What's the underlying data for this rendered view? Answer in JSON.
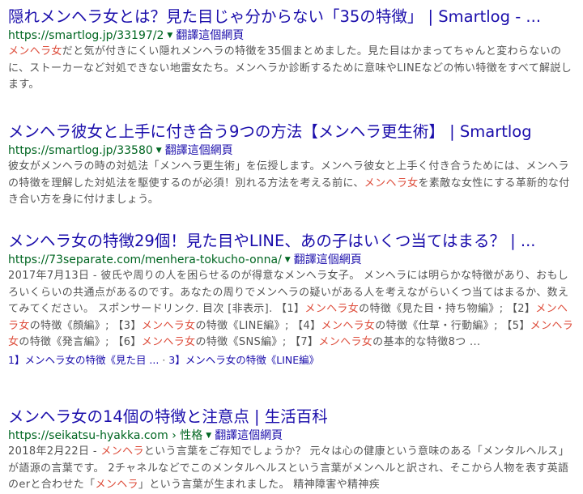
{
  "results": [
    {
      "title": "隠れメンヘラ女とは？見た目じゃ分からない「35の特徴」 | Smartlog - ...",
      "url": "https://smartlog.jp/33197/2",
      "translate": "翻譯這個網頁",
      "snippet": [
        {
          "t": "メンヘラ女",
          "h": true
        },
        {
          "t": "だと気が付きにくい隠れメンヘラの特徴を35個まとめました。見た目はかまってちゃんと変わらないのに、ストーカーなど対処できない地雷女たち。メンヘラか診断するために意味やLINEなどの怖い特徴をすべて解説します。",
          "h": false
        }
      ]
    },
    {
      "title": "メンヘラ彼女と上手に付き合う9つの方法【メンヘラ更生術】 | Smartlog",
      "url": "https://smartlog.jp/33580",
      "translate": "翻譯這個網頁",
      "snippet": [
        {
          "t": "彼女がメンヘラの時の対処法「メンヘラ更生術」を伝授します。メンヘラ彼女と上手く付き合うためには、メンヘラの特徴を理解した対処法を駆使するのが必須！別れる方法を考える前に、",
          "h": false
        },
        {
          "t": "メンヘラ女",
          "h": true
        },
        {
          "t": "を素敵な女性にする革新的な付き合い方を身に付けましょう。",
          "h": false
        }
      ]
    },
    {
      "title": "メンヘラ女の特徴29個！見た目やLINE、あの子はいくつ当てはまる？ | ...",
      "url": "https://73separate.com/menhera-tokucho-onna/",
      "translate": "翻譯這個網頁",
      "snippet": [
        {
          "t": "2017年7月13日 - 彼氏や周りの人を困らせるのが得意なメンヘラ女子。 メンヘラには明らかな特徴があり、おもしろいくらいの共通点があるのです。あなたの周りでメンヘラの疑いがある人を考えながらいくつ当てはまるか、数えてみてください。 スポンサードリンク. 目次 [非表示]. 【1】",
          "h": false
        },
        {
          "t": "メンヘラ女",
          "h": true
        },
        {
          "t": "の特徴《見た目・持ち物編》; 【2】",
          "h": false
        },
        {
          "t": "メンヘラ女",
          "h": true
        },
        {
          "t": "の特徴《顔編》; 【3】",
          "h": false
        },
        {
          "t": "メンヘラ女",
          "h": true
        },
        {
          "t": "の特徴《LINE編》; 【4】",
          "h": false
        },
        {
          "t": "メンヘラ女",
          "h": true
        },
        {
          "t": "の特徴《仕草・行動編》; 【5】",
          "h": false
        },
        {
          "t": "メンヘラ女",
          "h": true
        },
        {
          "t": "の特徴《発言編》; 【6】",
          "h": false
        },
        {
          "t": "メンヘラ女",
          "h": true
        },
        {
          "t": "の特徴《SNS編》; 【7】",
          "h": false
        },
        {
          "t": "メンヘラ女",
          "h": true
        },
        {
          "t": "の基本的な特徴8つ ...",
          "h": false
        }
      ],
      "sitelinks": [
        "1】メンヘラ女の特徴《見た目 ...",
        "3】メンヘラ女の特徴《LINE編》"
      ],
      "sitelink_sep": " · "
    },
    {
      "title": "メンヘラ女の14個の特徴と注意点 | 生活百科",
      "url": "https://seikatsu-hyakka.com",
      "breadcrumb": " › 性格",
      "translate": "翻譯這個網頁",
      "snippet": [
        {
          "t": "2018年2月22日 - ",
          "h": false
        },
        {
          "t": "メンヘラ",
          "h": true
        },
        {
          "t": "という言葉をご存知でしょうか？ 元々は心の健康という意味のある「メンタルヘルス」が語源の言葉です。 2チャネルなどでこのメンタルヘルスという言葉がメンヘルと訳され、そこから人物を表す英語のerと合わせた「",
          "h": false
        },
        {
          "t": "メンヘラ",
          "h": true
        },
        {
          "t": "」という言葉が生まれました。 精神障害や精神疾",
          "h": false
        }
      ]
    }
  ]
}
